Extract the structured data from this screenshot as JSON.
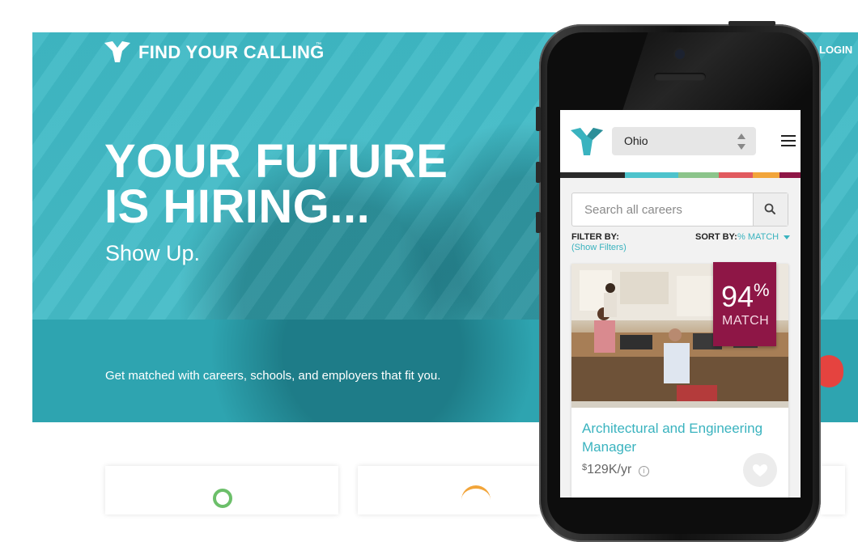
{
  "desktop": {
    "brand": {
      "name": "FIND YOUR CALLING",
      "tm": "™"
    },
    "nav": {
      "login": "LOGIN"
    },
    "hero": {
      "headline_line1": "YOUR FUTURE",
      "headline_line2": "IS HIRING...",
      "subhead": "Show Up.",
      "tagline": "Get matched with careers, schools, and employers that fit you."
    }
  },
  "mobile": {
    "header": {
      "state_value": "Ohio"
    },
    "color_strip": [
      "#2a2a2a",
      "#4dc3cc",
      "#8cc48b",
      "#e15a5e",
      "#f2a53a",
      "#8e1646"
    ],
    "search": {
      "placeholder": "Search all careers"
    },
    "filters": {
      "filter_label": "FILTER BY:",
      "show_filters": "(Show Filters)",
      "sort_label": "SORT BY:",
      "sort_value": "% MATCH"
    },
    "career": {
      "match_value": "94",
      "match_sign": "%",
      "match_word": "MATCH",
      "title": "Architectural and Engineering Manager",
      "salary_currency": "$",
      "salary_value": "129K/yr",
      "info": "i"
    }
  },
  "colors": {
    "hero_teal": "#47bfca",
    "accent_teal": "#3ab3bf",
    "match_badge": "#8e1646",
    "cta_red": "#e5433f"
  },
  "icons": [
    "logo-mark-icon",
    "search-icon",
    "menu-icon",
    "select-arrows-icon",
    "info-icon",
    "heart-icon",
    "sort-caret-icon"
  ]
}
